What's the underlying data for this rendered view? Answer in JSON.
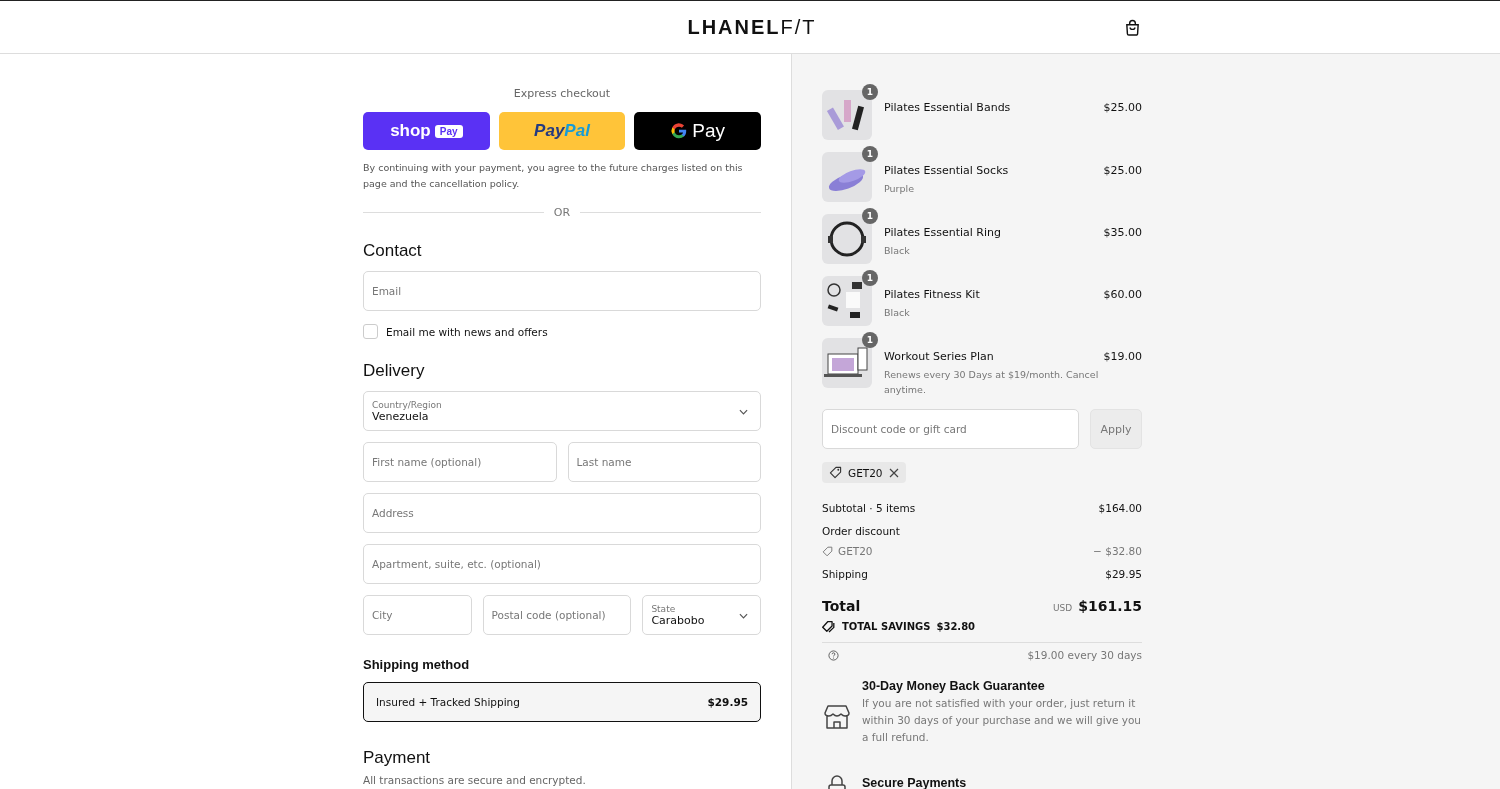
{
  "header": {
    "logo_bold": "LHANEL",
    "logo_light": "F/T"
  },
  "express": {
    "title": "Express checkout",
    "buttons": [
      {
        "kind": "shop",
        "label": "shop",
        "badge": "Pay"
      },
      {
        "kind": "paypal",
        "label": "Pay",
        "label2": "Pal"
      },
      {
        "kind": "gpay",
        "label": "Pay"
      }
    ],
    "notice": "By continuing with your payment, you agree to the future charges listed on this page and the cancellation policy.",
    "divider": "OR"
  },
  "contact": {
    "heading": "Contact",
    "email": {
      "placeholder": "Email"
    },
    "newsletter": {
      "label": "Email me with news and offers",
      "checked": false
    }
  },
  "delivery": {
    "heading": "Delivery",
    "rows": [
      [
        {
          "kind": "select",
          "label": "Country/Region",
          "value": "Venezuela"
        }
      ],
      [
        {
          "kind": "input",
          "placeholder": "First name (optional)"
        },
        {
          "kind": "input",
          "placeholder": "Last name"
        }
      ],
      [
        {
          "kind": "input",
          "placeholder": "Address"
        }
      ],
      [
        {
          "kind": "input",
          "placeholder": "Apartment, suite, etc. (optional)"
        }
      ],
      [
        {
          "kind": "input",
          "placeholder": "City"
        },
        {
          "kind": "input",
          "placeholder": "Postal code (optional)"
        },
        {
          "kind": "select",
          "label": "State",
          "value": "Carabobo"
        }
      ]
    ]
  },
  "shipping_method": {
    "heading": "Shipping method",
    "options": [
      {
        "name": "Insured + Tracked Shipping",
        "price": "$29.95",
        "selected": true
      }
    ]
  },
  "payment": {
    "heading": "Payment",
    "note": "All transactions are secure and encrypted."
  },
  "cart": {
    "items": [
      {
        "kind": "bands",
        "qty": "1",
        "name": "Pilates Essential Bands",
        "price": "$25.00"
      },
      {
        "kind": "socks",
        "qty": "1",
        "name": "Pilates Essential Socks",
        "variant": "Purple",
        "price": "$25.00"
      },
      {
        "kind": "ring",
        "qty": "1",
        "name": "Pilates Essential Ring",
        "variant": "Black",
        "price": "$35.00"
      },
      {
        "kind": "kit",
        "qty": "1",
        "name": "Pilates Fitness Kit",
        "variant": "Black",
        "price": "$60.00"
      },
      {
        "kind": "plan",
        "qty": "1",
        "name": "Workout Series Plan",
        "variant": "Renews every 30 Days at $19/month. Cancel anytime.",
        "price": "$19.00"
      }
    ],
    "discount": {
      "placeholder": "Discount code or gift card",
      "button": "Apply",
      "applied": "GET20"
    },
    "summary": [
      {
        "kind": "line",
        "label": "Subtotal · 5 items",
        "value": "$164.00"
      },
      {
        "kind": "heading",
        "label": "Order discount"
      },
      {
        "kind": "code",
        "label": "GET20",
        "value": "− $32.80"
      },
      {
        "kind": "line",
        "label": "Shipping",
        "value": "$29.95"
      }
    ],
    "total": {
      "label": "Total",
      "currency": "USD",
      "value": "$161.15",
      "savings_label": "TOTAL SAVINGS",
      "savings_value": "$32.80"
    },
    "recurring": "$19.00 every 30 days",
    "features": [
      {
        "kind": "store",
        "title": "30-Day Money Back Guarantee",
        "text": "If you are not satisfied with your order, just return it within 30 days of your purchase and we will give you a full refund."
      },
      {
        "kind": "lock",
        "title": "Secure Payments"
      }
    ]
  }
}
